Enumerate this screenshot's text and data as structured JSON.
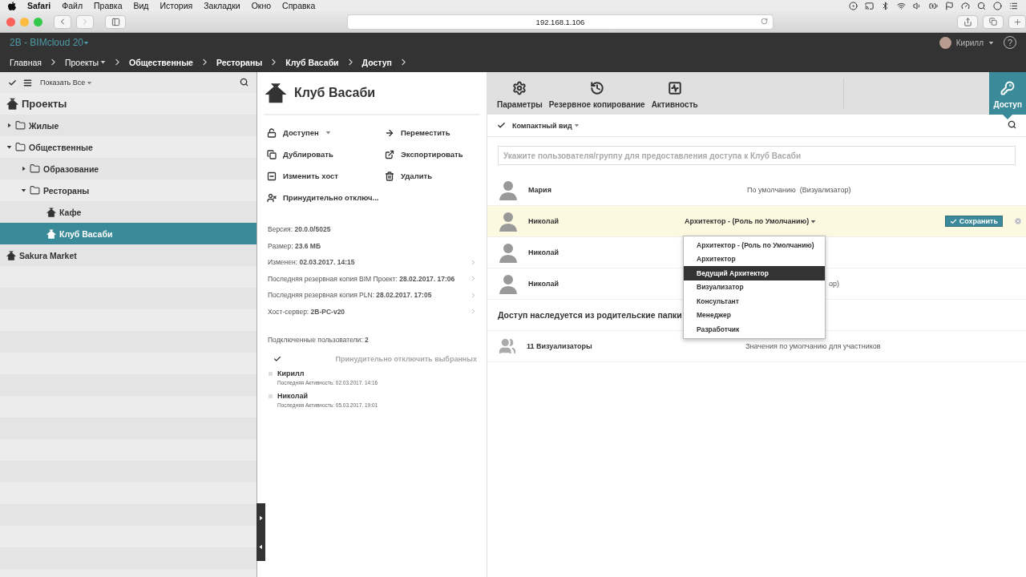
{
  "menubar": {
    "app": "Safari",
    "items": [
      "Файл",
      "Правка",
      "Вид",
      "История",
      "Закладки",
      "Окно",
      "Справка"
    ]
  },
  "browser": {
    "url": "192.168.1.106"
  },
  "app_header": {
    "product": "2B - BIMcloud 20",
    "user": "Кирилл",
    "help": "?"
  },
  "breadcrumb": [
    {
      "label": "Главная",
      "bold": false,
      "dropdown": false
    },
    {
      "label": "Проекты",
      "bold": false,
      "dropdown": true
    },
    {
      "label": "Общественные",
      "bold": true,
      "dropdown": false
    },
    {
      "label": "Рестораны",
      "bold": true,
      "dropdown": false
    },
    {
      "label": "Клуб Васаби",
      "bold": true,
      "dropdown": false
    },
    {
      "label": "Доступ",
      "bold": true,
      "dropdown": false
    }
  ],
  "sidebar": {
    "filter": "Показать Все",
    "tree": [
      {
        "label": "Проекты",
        "kind": "root",
        "selected": false,
        "children": [
          {
            "label": "Жилые",
            "kind": "folder",
            "expanded": false,
            "selected": false
          },
          {
            "label": "Общественные",
            "kind": "folder",
            "expanded": true,
            "selected": false,
            "children": [
              {
                "label": "Образование",
                "kind": "folder",
                "expanded": false,
                "selected": false
              },
              {
                "label": "Рестораны",
                "kind": "folder",
                "expanded": true,
                "selected": false,
                "children": [
                  {
                    "label": "Кафе",
                    "kind": "project",
                    "selected": false
                  },
                  {
                    "label": "Клуб Васаби",
                    "kind": "project",
                    "selected": true
                  }
                ]
              }
            ]
          },
          {
            "label": "Sakura Market",
            "kind": "project",
            "selected": false
          }
        ]
      }
    ]
  },
  "project": {
    "title": "Клуб Васаби",
    "actions": [
      {
        "label": "Доступен",
        "kind": "access",
        "dropdown": true
      },
      {
        "label": "Переместить",
        "kind": "move",
        "dropdown": false
      },
      {
        "label": "Дублировать",
        "kind": "duplicate",
        "dropdown": false
      },
      {
        "label": "Экспортировать",
        "kind": "export",
        "dropdown": false
      },
      {
        "label": "Изменить хост",
        "kind": "host",
        "dropdown": false
      },
      {
        "label": "Удалить",
        "kind": "delete",
        "dropdown": false
      },
      {
        "label": "Принудительно отключ...",
        "kind": "disconnect",
        "dropdown": false
      }
    ],
    "info": [
      {
        "text": "Версия: **20.0.0/5025**",
        "link": false
      },
      {
        "text": "Размер: **23.6 МБ**",
        "link": false
      },
      {
        "text": "Изменен: **02.03.2017. 14:15**",
        "link": true
      },
      {
        "text": "Последняя резервная копия BIM Проект: **28.02.2017. 17:06**",
        "link": true
      },
      {
        "text": "Последняя резервная копия PLN: **28.02.2017. 17:05**",
        "link": true
      },
      {
        "text": "Хост-сервер: **2B-PC-v20**",
        "link": true
      }
    ],
    "connected": "Подключенные пользователи: **2**",
    "disconnect_button": {
      "label": "Принудительно отключить выбранных",
      "disabled": true
    },
    "users": [
      {
        "name": "Кирилл",
        "activity": "Последняя Активность: 02.03.2017. 14:16",
        "checked": false
      },
      {
        "name": "Николай",
        "activity": "Последняя Активность: 05.03.2017. 19:01",
        "checked": false
      }
    ]
  },
  "tabs": [
    {
      "label": "Параметры",
      "kind": "settings",
      "selected": false
    },
    {
      "label": "Резервное копирование",
      "kind": "backup",
      "selected": false
    },
    {
      "label": "Активность",
      "kind": "activity",
      "selected": false
    },
    {
      "label": "Доступ",
      "kind": "access",
      "selected": true
    }
  ],
  "access": {
    "view": "Компактный вид",
    "search": {
      "placeholder": "Укажите пользователя/группу для предоставления доступа к Клуб Васаби"
    },
    "users": [
      {
        "name": "Мария",
        "role": "По умолчанию  (Визуализатор)",
        "editing": false
      },
      {
        "name": "Николай",
        "role": "Архитектор - (Роль по Умолчанию)",
        "editing": true
      },
      {
        "name": "Николай",
        "editing": false
      },
      {
        "name": "Николай",
        "role": "ор)",
        "editing": false,
        "covered": true
      }
    ],
    "save_button": "Сохранить",
    "inherited_title": "Доступ наследуется из родительские папки",
    "groups": [
      {
        "name": "11 Визуализаторы",
        "role": "Значения по умолчанию для участников"
      }
    ],
    "role_menu": [
      {
        "label": "Архитектор - (Роль по Умолчанию)",
        "selected": false
      },
      {
        "label": "Архитектор",
        "selected": false
      },
      {
        "label": "Ведущий Архитектор",
        "selected": true
      },
      {
        "label": "Визуализатор",
        "selected": false
      },
      {
        "label": "Консультант",
        "selected": false
      },
      {
        "label": "Менеджер",
        "selected": false
      },
      {
        "label": "Разработчик",
        "selected": false
      }
    ]
  }
}
